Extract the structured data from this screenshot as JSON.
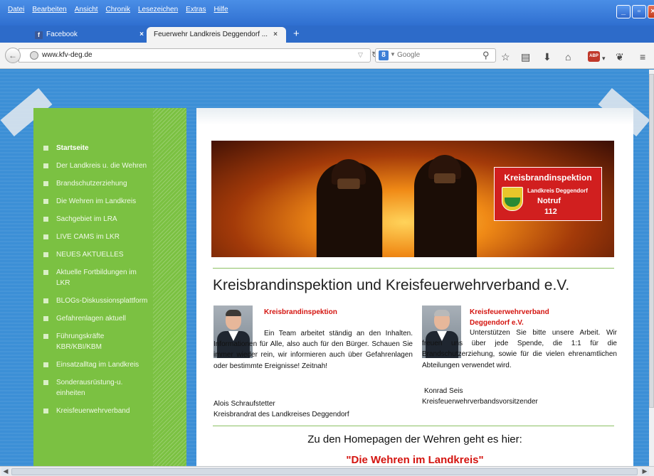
{
  "menubar": [
    "Datei",
    "Bearbeiten",
    "Ansicht",
    "Chronik",
    "Lesezeichen",
    "Extras",
    "Hilfe"
  ],
  "tabs": [
    {
      "label": "Facebook",
      "icon": "facebook-icon"
    },
    {
      "label": "Feuerwehr Landkreis Deggendorf ...",
      "icon": null
    }
  ],
  "address_bar": {
    "url": "www.kfv-deg.de"
  },
  "search_bar": {
    "engine": "8",
    "placeholder": "Google"
  },
  "sidebar": {
    "items": [
      {
        "label": "Startseite",
        "active": true
      },
      {
        "label": "Der Landkreis u. die Wehren"
      },
      {
        "label": "Brandschutzerziehung"
      },
      {
        "label": "Die Wehren im Landkreis"
      },
      {
        "label": "Sachgebiet im LRA"
      },
      {
        "label": "LIVE CAMS im LKR"
      },
      {
        "label": "NEUES AKTUELLES"
      },
      {
        "label": "Aktuelle Fortbildungen im LKR"
      },
      {
        "label": "BLOGs-Diskussionsplattform"
      },
      {
        "label": "Gefahrenlagen aktuell"
      },
      {
        "label": "Führungskräfte KBR/KBI/KBM"
      },
      {
        "label": "Einsatzalltag im Landkreis"
      },
      {
        "label": "Sonderausrüstung-u. einheiten"
      },
      {
        "label": "Kreisfeuerwehrverband"
      }
    ]
  },
  "banner": {
    "sign_title": "Kreisbrandinspektion",
    "sign_sub": "Landkreis Deggendorf",
    "sign_notruf": "Notruf",
    "sign_number": "112"
  },
  "main": {
    "heading": "Kreisbrandinspektion und Kreisfeuerwehrverband e.V.",
    "sections": [
      {
        "title": "Kreisbrandinspektion",
        "text": "Ein Team arbeitet ständig an den Inhalten. Informationen für Alle, also auch für den Bürger. Schauen Sie immer wieder rein, wir informieren auch über Gefahrenlagen oder bestimmte Ereignisse! Zeitnah!",
        "signature_name": "Alois Schraufstetter",
        "signature_role": "Kreisbrandrat des Landkreises Deggendorf"
      },
      {
        "title": "Kreisfeuerwehrverband Deggendorf e.V.",
        "text": "Unterstützen Sie bitte unsere Arbeit. Wir freuen uns über jede Spende, die 1:1 für die Brandschutzerziehung, sowie für die vielen ehrenamtlichen Abteilungen verwendet wird.",
        "signature_name": "Konrad Seis",
        "signature_role": "Kreisfeuerwehrverbandsvorsitzender"
      }
    ],
    "homepages_heading": "Zu den Homepagen der Wehren geht es hier:",
    "homepages_link": "\"Die Wehren im Landkreis\""
  },
  "colors": {
    "sidebar_green": "#7bc142",
    "page_blue": "#3c8fd6",
    "accent_red": "#d4140f"
  }
}
